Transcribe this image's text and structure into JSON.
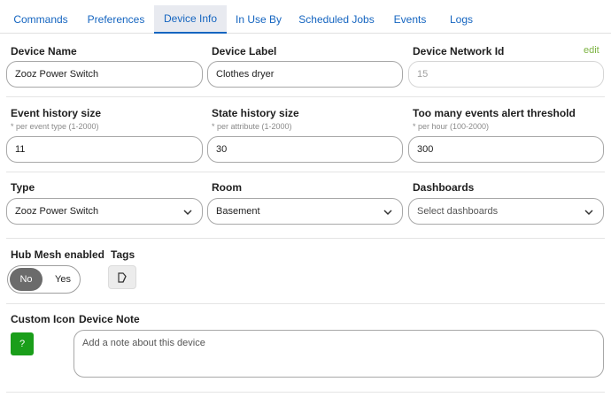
{
  "tabs": [
    {
      "label": "Commands"
    },
    {
      "label": "Preferences"
    },
    {
      "label": "Device Info",
      "active": true
    },
    {
      "label": "In Use By"
    },
    {
      "label": "Scheduled Jobs"
    },
    {
      "label": "Events"
    },
    {
      "label": "Logs"
    }
  ],
  "device_name": {
    "label": "Device Name",
    "value": "Zooz Power Switch"
  },
  "device_label": {
    "label": "Device Label",
    "value": "Clothes dryer"
  },
  "network_id": {
    "label": "Device Network Id",
    "value": "15",
    "edit_label": "edit"
  },
  "event_history": {
    "label": "Event history size",
    "hint": "* per event type (1-2000)",
    "value": "11"
  },
  "state_history": {
    "label": "State history size",
    "hint": "* per attribute (1-2000)",
    "value": "30"
  },
  "alert_threshold": {
    "label": "Too many events alert threshold",
    "hint": "* per hour (100-2000)",
    "value": "300"
  },
  "type": {
    "label": "Type",
    "value": "Zooz Power Switch"
  },
  "room": {
    "label": "Room",
    "value": "Basement"
  },
  "dashboards": {
    "label": "Dashboards",
    "placeholder": "Select dashboards"
  },
  "hub_mesh": {
    "label": "Hub Mesh enabled",
    "no_label": "No",
    "yes_label": "Yes",
    "selected": "No"
  },
  "tags": {
    "label": "Tags"
  },
  "custom_icon": {
    "label": "Custom Icon",
    "symbol": "?"
  },
  "device_note": {
    "label": "Device Note",
    "placeholder": "Add a note about this device"
  },
  "colors": {
    "accent": "#1565c0",
    "edit": "#7cb342",
    "icon_bg": "#1a9e1a",
    "toggle_active": "#6b6b6b"
  }
}
